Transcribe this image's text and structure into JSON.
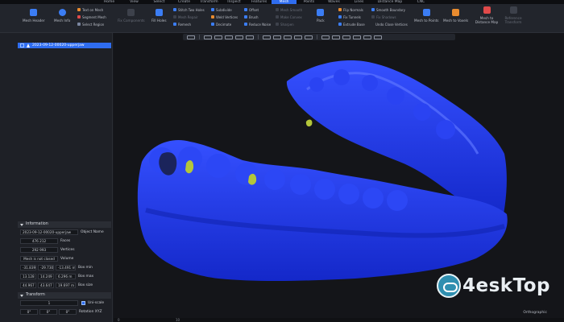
{
  "menu": {
    "items": [
      "Home",
      "View",
      "Select",
      "Create",
      "Transform",
      "Inspect",
      "Features",
      "Mesh",
      "Points",
      "Waves",
      "Lines",
      "Distance Map",
      "CNC"
    ],
    "active": "Mesh"
  },
  "ribbon": {
    "mesh_header": "Mesh Header",
    "mesh_info": "Mesh Info",
    "text_on_mesh": "Text on Mesh",
    "segment_mesh": "Segment Mesh",
    "select_region": "Select Region",
    "fix_components": "Fix Components",
    "fill_holes": "Fill Holes",
    "stitch_two_holes": "Stitch Two Holes",
    "subdivide": "Subdivide",
    "offset": "Offset",
    "mesh_smooth": "Mesh Smooth",
    "flip_normals": "Flip Normals",
    "smooth_boundary": "Smooth Boundary",
    "uv_segment": "UV Segment",
    "weld_vertices": "Weld Vertices",
    "make_convex": "Make Convex",
    "brush": "Brush",
    "mesh_repair": "Mesh Repair",
    "fix_tunnels": "Fix Tunnels",
    "fix_shadows": "Fix Shadows",
    "remesh": "Remesh",
    "decimate": "Decimate",
    "reduce_noise": "Reduce Noise",
    "sharpen": "Sharpen",
    "extrude_base": "Extrude Base",
    "undo_close_vertices": "Undo Close Vertices",
    "pack": "Pack",
    "mesh_to_points": "Mesh to Points",
    "mesh_to_voxels": "Mesh to Voxels",
    "mesh_to_distance_map": "Mesh to Distance Map",
    "reference_transform": "Reference Transform"
  },
  "tree": {
    "item": "2023-09-12-00020-upperjaw"
  },
  "information": {
    "title": "Information",
    "object_name_value": "2023-09-12-00020-upperjaw",
    "object_name_label": "Object Name",
    "faces_value": "476 212",
    "faces_label": "Faces",
    "vertices_value": "292 993",
    "vertices_label": "Vertices",
    "closed_value": "Mesh is not closed",
    "volume_label": "Volume",
    "box_min": [
      "-31.839 m",
      "-29.730 m",
      "-13.491 m"
    ],
    "box_min_label": "Box min",
    "box_max": [
      "13.128 m",
      "14.249 m",
      "6.296 m"
    ],
    "box_max_label": "Box max",
    "box_size": [
      "44.967 m",
      "43.647 m",
      "19.697 m"
    ],
    "box_size_label": "Box size"
  },
  "transform": {
    "title": "Transform",
    "uni_scale_value": "1",
    "uni_scale_label": "Uni-scale",
    "rotation": [
      "0°",
      "0°",
      "0°"
    ],
    "rotation_label": "Rotation XYZ"
  },
  "viewport": {
    "projection": "Orthographic",
    "ruler_ticks": [
      "0",
      "10"
    ]
  },
  "watermark": {
    "text": "4eskTop"
  },
  "colors": {
    "accent": "#2f6df0",
    "mesh_blue": "#1f39f5",
    "mesh_highlight": "#b4c63a"
  }
}
